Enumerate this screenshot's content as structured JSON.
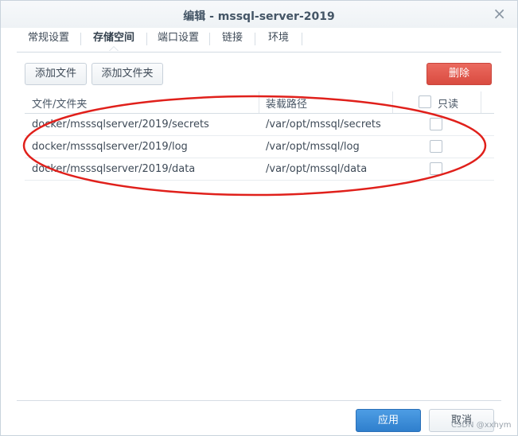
{
  "window": {
    "title": "编辑 - mssql-server-2019",
    "close_glyph": "×"
  },
  "tabs": [
    {
      "label": "常规设置",
      "active": false
    },
    {
      "label": "存储空间",
      "active": true
    },
    {
      "label": "端口设置",
      "active": false
    },
    {
      "label": "链接",
      "active": false
    },
    {
      "label": "环境",
      "active": false
    }
  ],
  "toolbar": {
    "add_file": "添加文件",
    "add_folder": "添加文件夹",
    "delete": "删除"
  },
  "table": {
    "headers": {
      "path": "文件/文件夹",
      "mount": "装载路径",
      "readonly": "只读"
    },
    "rows": [
      {
        "path": "docker/msssqlserver/2019/secrets",
        "mount": "/var/opt/mssql/secrets",
        "readonly": false
      },
      {
        "path": "docker/msssqlserver/2019/log",
        "mount": "/var/opt/mssql/log",
        "readonly": false
      },
      {
        "path": "docker/msssqlserver/2019/data",
        "mount": "/var/opt/mssql/data",
        "readonly": false
      }
    ]
  },
  "footer": {
    "apply": "应用",
    "cancel": "取消"
  },
  "watermark": "CSDN @xxhym",
  "colors": {
    "annotation_ellipse": "#e0201b",
    "danger": "#d94b40",
    "primary": "#2f7fcd"
  }
}
